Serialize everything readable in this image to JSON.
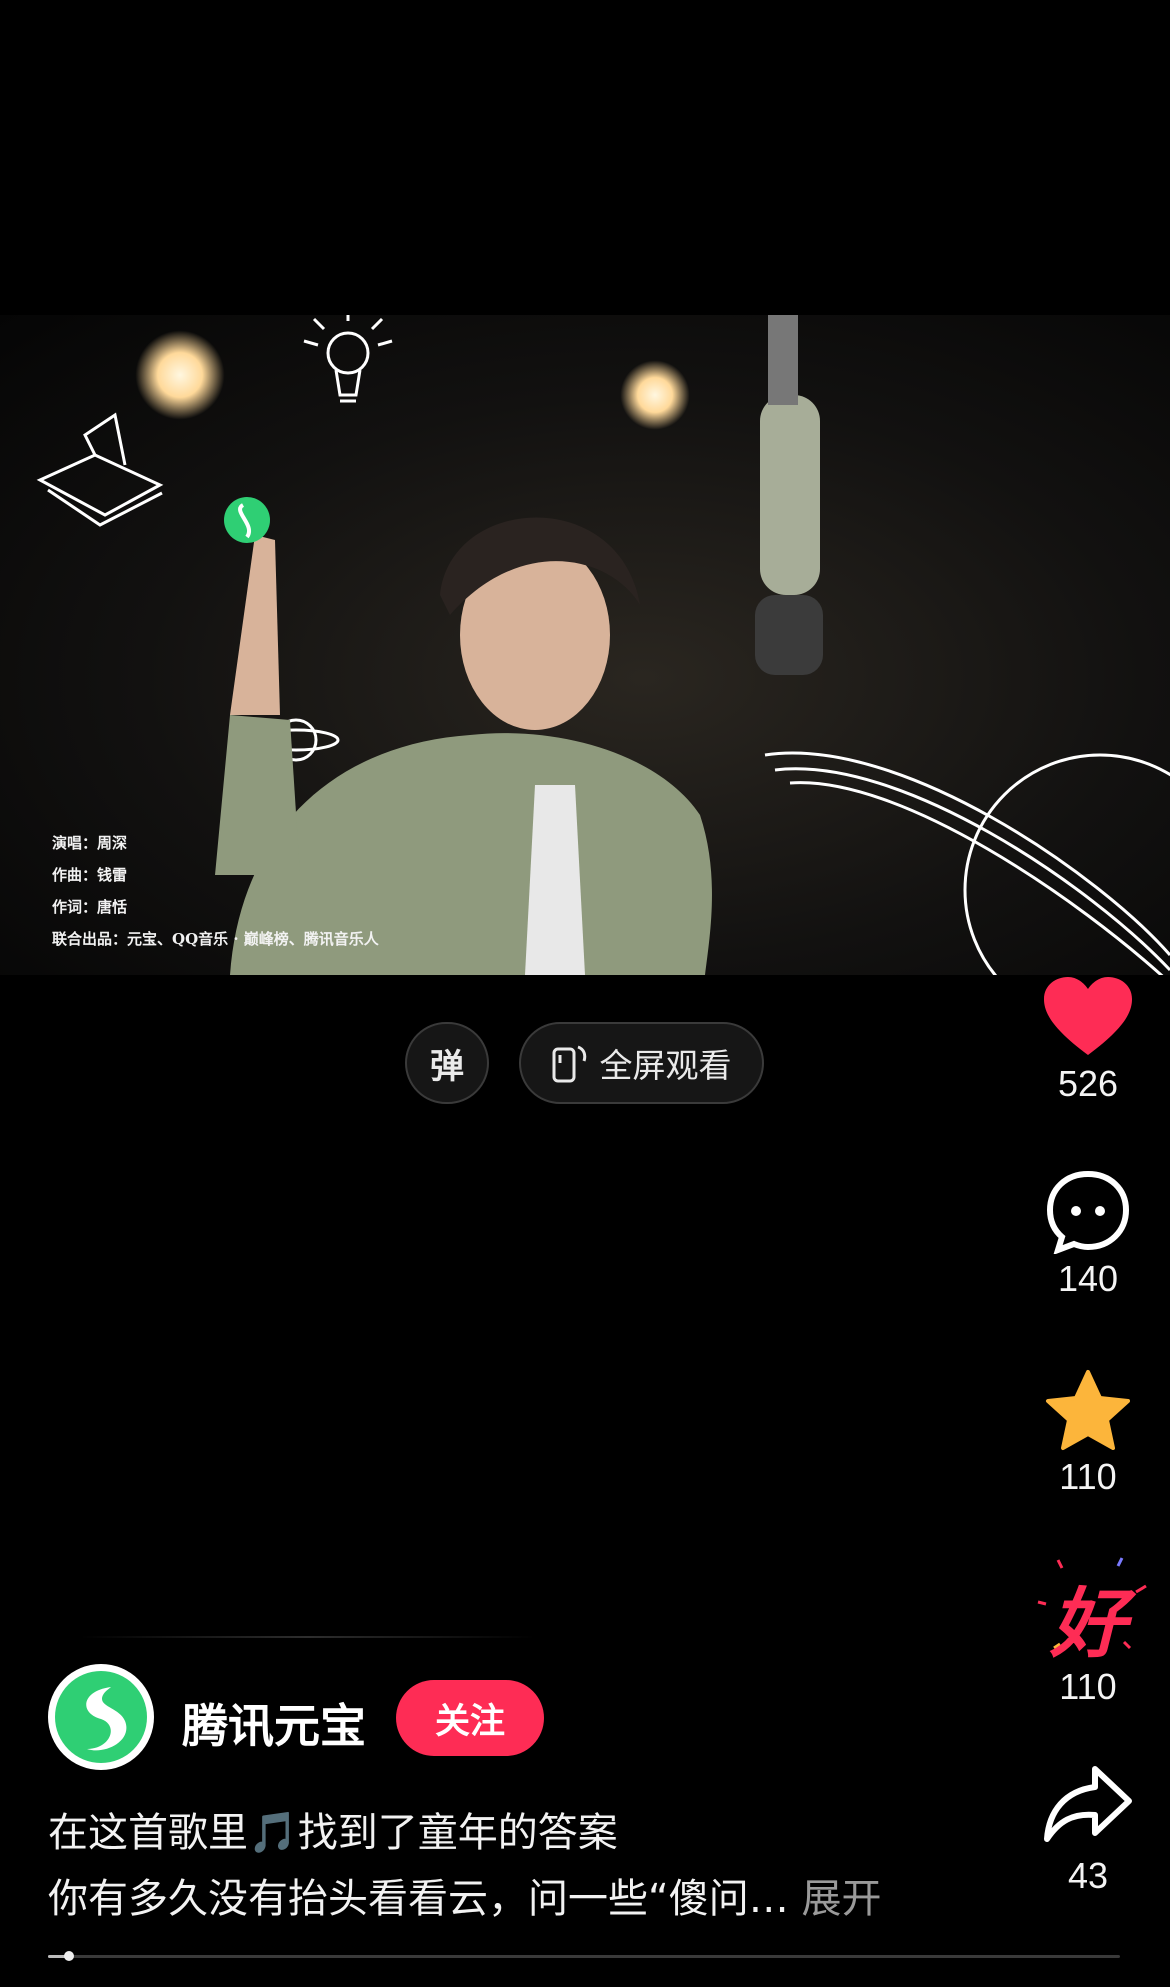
{
  "video": {
    "credits": [
      "演唱：周深",
      "作曲：钱雷",
      "作词：唐恬",
      "联合出品：元宝、QQ音乐 · 巅峰榜、腾讯音乐人"
    ]
  },
  "controls": {
    "danmaku_label": "弹",
    "fullscreen_label": "全屏观看"
  },
  "actions": {
    "likes": "526",
    "comments": "140",
    "favorites": "110",
    "good": "110",
    "good_label": "好",
    "shares": "43"
  },
  "author": {
    "name": "腾讯元宝",
    "follow_label": "关注"
  },
  "caption": {
    "line1": "在这首歌里🎵找到了童年的答案",
    "line2": "你有多久没有抬头看看云，问一些“傻问…",
    "expand": "展开"
  },
  "progress": {
    "fraction": 0.02
  },
  "colors": {
    "accent": "#fe2c55",
    "like": "#fe2c55",
    "star": "#fcb53b",
    "brand_green": "#2fcf74"
  }
}
